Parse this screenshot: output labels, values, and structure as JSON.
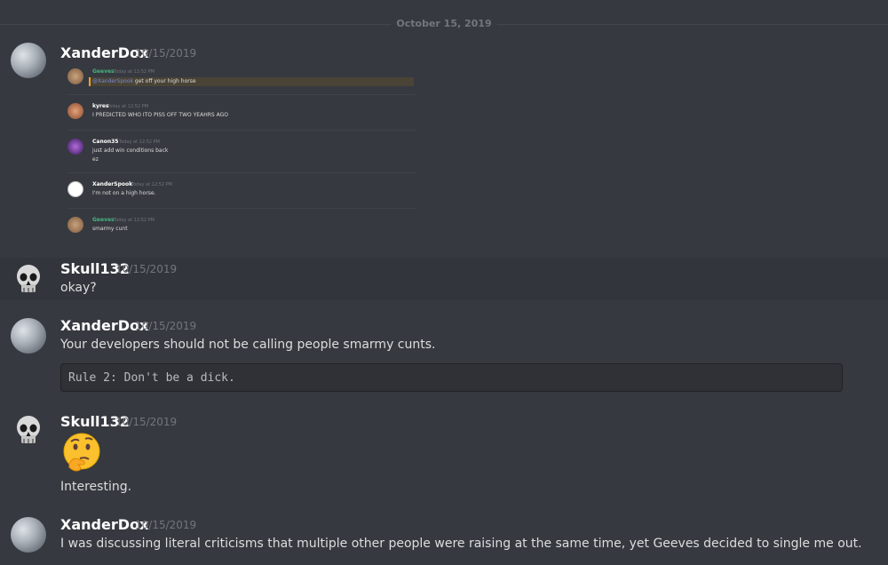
{
  "date_divider": "October 15, 2019",
  "messages": [
    {
      "author": "XanderDox",
      "timestamp": "10/15/2019",
      "embed": [
        {
          "author": "Geeves",
          "time": "Today at 12:52 PM",
          "mention": "@XanderSpook",
          "text": " get off your high horse",
          "name_color": "#43b581"
        },
        {
          "author": "kyres",
          "time": "Today at 12:52 PM",
          "text": "I PREDICTED WHO ITO PISS OFF TWO YEAHRS AGO"
        },
        {
          "author": "Canon35",
          "time": "Today at 12:52 PM",
          "text": "just add win conditions back",
          "text2": "ez"
        },
        {
          "author": "XanderSpook",
          "time": "Today at 12:52 PM",
          "text": "I'm not on a high horse."
        },
        {
          "author": "Geeves",
          "time": "Today at 12:52 PM",
          "text": "smarmy cunt",
          "name_color": "#43b581"
        }
      ]
    },
    {
      "author": "Skull132",
      "timestamp": "10/15/2019",
      "text": "okay?"
    },
    {
      "author": "XanderDox",
      "timestamp": "10/15/2019",
      "text": "Your developers should not be calling people smarmy cunts.",
      "code": "Rule 2: Don't be a dick."
    },
    {
      "author": "Skull132",
      "timestamp": "10/15/2019",
      "emoji": "thinking-face",
      "text": "Interesting."
    },
    {
      "author": "XanderDox",
      "timestamp": "10/15/2019",
      "text": "I was discussing literal criticisms that multiple other people were raising at the same time, yet Geeves decided to single me out."
    }
  ],
  "colors": {
    "background": "#36393f",
    "hover": "#32353b",
    "username": "#ffffff",
    "timestamp": "#72767d",
    "text": "#dcddde",
    "mention": "#7289da"
  }
}
